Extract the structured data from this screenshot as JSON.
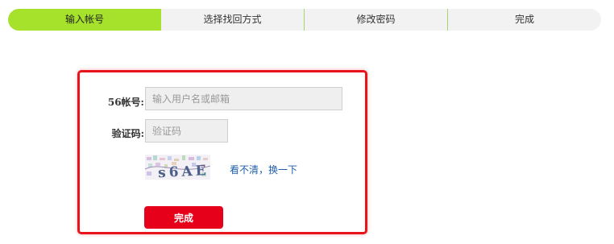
{
  "steps": [
    {
      "label": "输入帐号",
      "active": true
    },
    {
      "label": "选择找回方式",
      "active": false
    },
    {
      "label": "修改密码",
      "active": false
    },
    {
      "label": "完成",
      "active": false
    }
  ],
  "form": {
    "account_label": "56帐号:",
    "account_placeholder": "输入用户名或邮箱",
    "captcha_label": "验证码:",
    "captcha_placeholder": "验证码",
    "captcha_text": "s6AE",
    "refresh_link": "看不清，换一下",
    "submit_label": "完成"
  },
  "colors": {
    "active_step": "#a6e22b",
    "panel_border": "#e8141c",
    "submit_bg": "#e6001a",
    "link": "#1f5ea8"
  }
}
